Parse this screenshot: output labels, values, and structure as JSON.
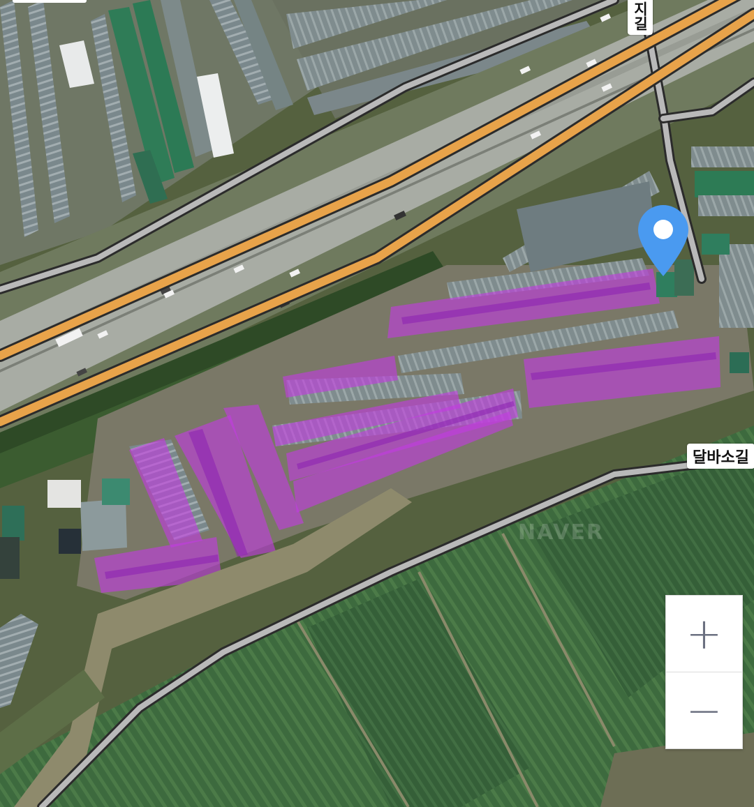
{
  "map": {
    "road_labels": {
      "dalbaso_road": "달바소길",
      "vertical_road_partial": "지길"
    },
    "watermark": "NAVER",
    "location_pin": {
      "icon": "location-pin-icon",
      "color": "#4a9af0"
    },
    "zoom_control": {
      "zoom_in_label": "+",
      "zoom_out_label": "−"
    },
    "colors": {
      "highway_fill": "#e8a34a",
      "road_casing": "#2b2b2b",
      "road_fill": "#b9b9b9",
      "greenhouse_highlight": "#c23be0",
      "field_green": "#3f6b3f"
    }
  }
}
